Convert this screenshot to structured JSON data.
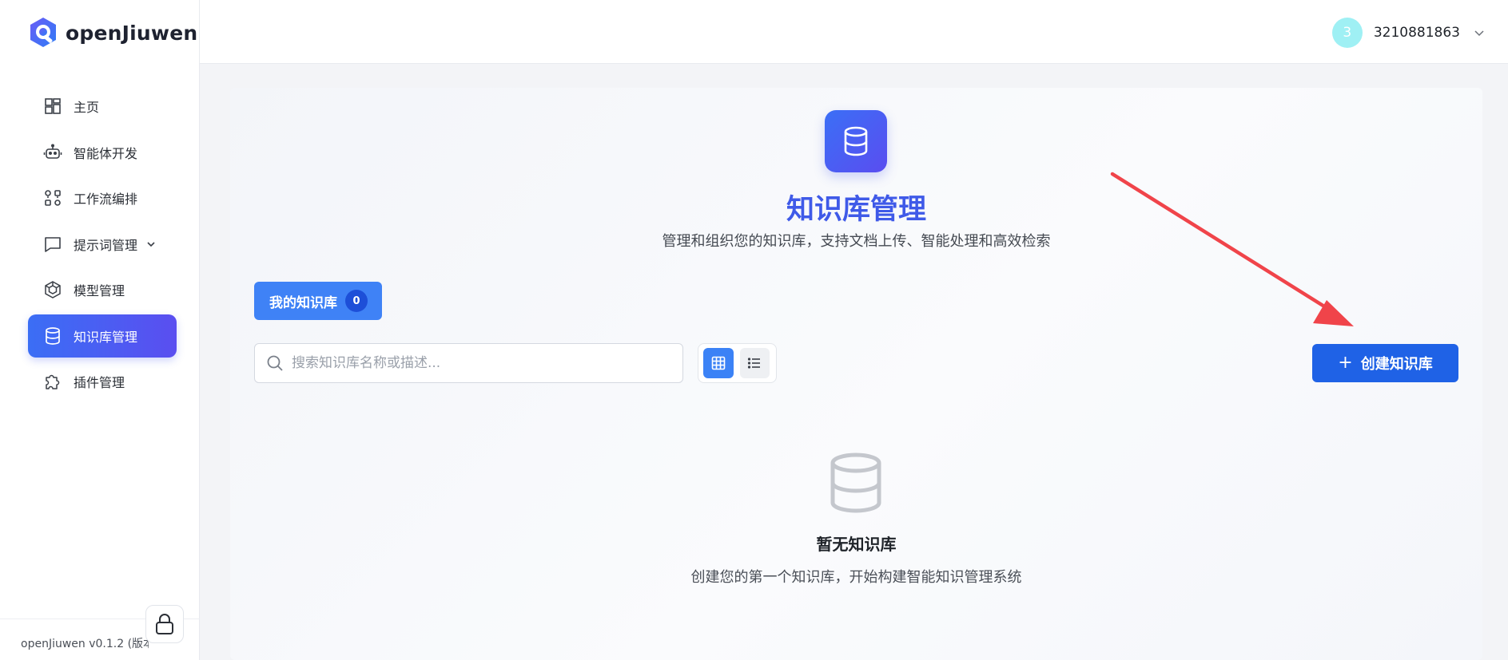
{
  "app": {
    "name": "openJiuwen",
    "version": "openJiuwen v0.1.2 (版本"
  },
  "sidebar": {
    "items": [
      {
        "label": "主页",
        "icon": "dashboard-icon"
      },
      {
        "label": "智能体开发",
        "icon": "robot-icon"
      },
      {
        "label": "工作流编排",
        "icon": "workflow-icon"
      },
      {
        "label": "提示词管理",
        "icon": "message-icon",
        "has_submenu": true
      },
      {
        "label": "模型管理",
        "icon": "model-icon"
      },
      {
        "label": "知识库管理",
        "icon": "database-icon",
        "active": true
      },
      {
        "label": "插件管理",
        "icon": "puzzle-icon"
      }
    ]
  },
  "header": {
    "user": {
      "avatar_letter": "3",
      "name": "3210881863"
    }
  },
  "main": {
    "title": "知识库管理",
    "subtitle": "管理和组织您的知识库，支持文档上传、智能处理和高效检索",
    "tab": {
      "label": "我的知识库",
      "count": "0"
    },
    "search": {
      "placeholder": "搜索知识库名称或描述...",
      "value": ""
    },
    "view_mode": "grid",
    "create_button": "创建知识库",
    "empty": {
      "title": "暂无知识库",
      "subtitle": "创建您的第一个知识库，开始构建智能知识管理系统"
    }
  },
  "colors": {
    "accent": "#3f5ae8",
    "primary_button": "#1f62e6",
    "annotation_arrow": "#f0444a"
  }
}
